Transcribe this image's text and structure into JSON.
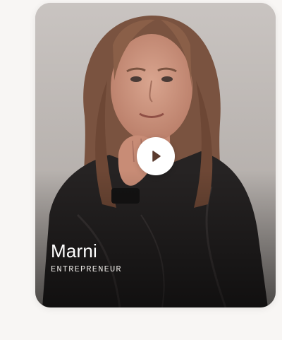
{
  "card": {
    "name": "Marni",
    "role": "ENTREPRENEUR",
    "photo": "portrait of a woman with long brown hair resting chin on hand",
    "play_icon": "play-icon",
    "colors": {
      "background": "#f8f6f4",
      "card_bg": "#bfbab6",
      "accent": "#5a3b2e"
    }
  }
}
